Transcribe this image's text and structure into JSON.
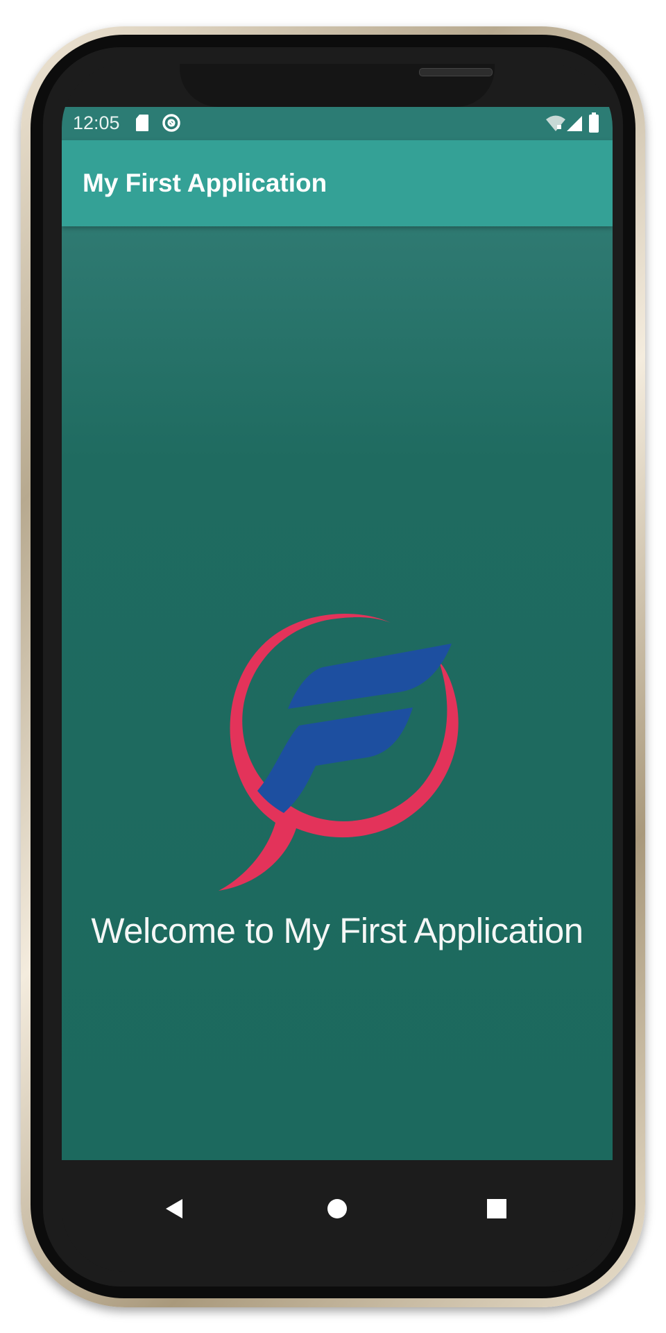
{
  "status_bar": {
    "time": "12:05",
    "icons": [
      "sd-card-icon",
      "sync-icon",
      "wifi-icon",
      "signal-icon",
      "battery-icon"
    ]
  },
  "app_bar": {
    "title": "My First Application",
    "color": "#34a196"
  },
  "main": {
    "logo": "f-logo-icon",
    "welcome_text": "Welcome to My First Application",
    "background_color": "#1c695e"
  },
  "nav_bar": {
    "buttons": [
      "back-icon",
      "home-icon",
      "recents-icon"
    ]
  },
  "colors": {
    "logo_ring": "#e3335a",
    "logo_letter": "#1d4fa0",
    "status_bar": "#2c7c74"
  }
}
